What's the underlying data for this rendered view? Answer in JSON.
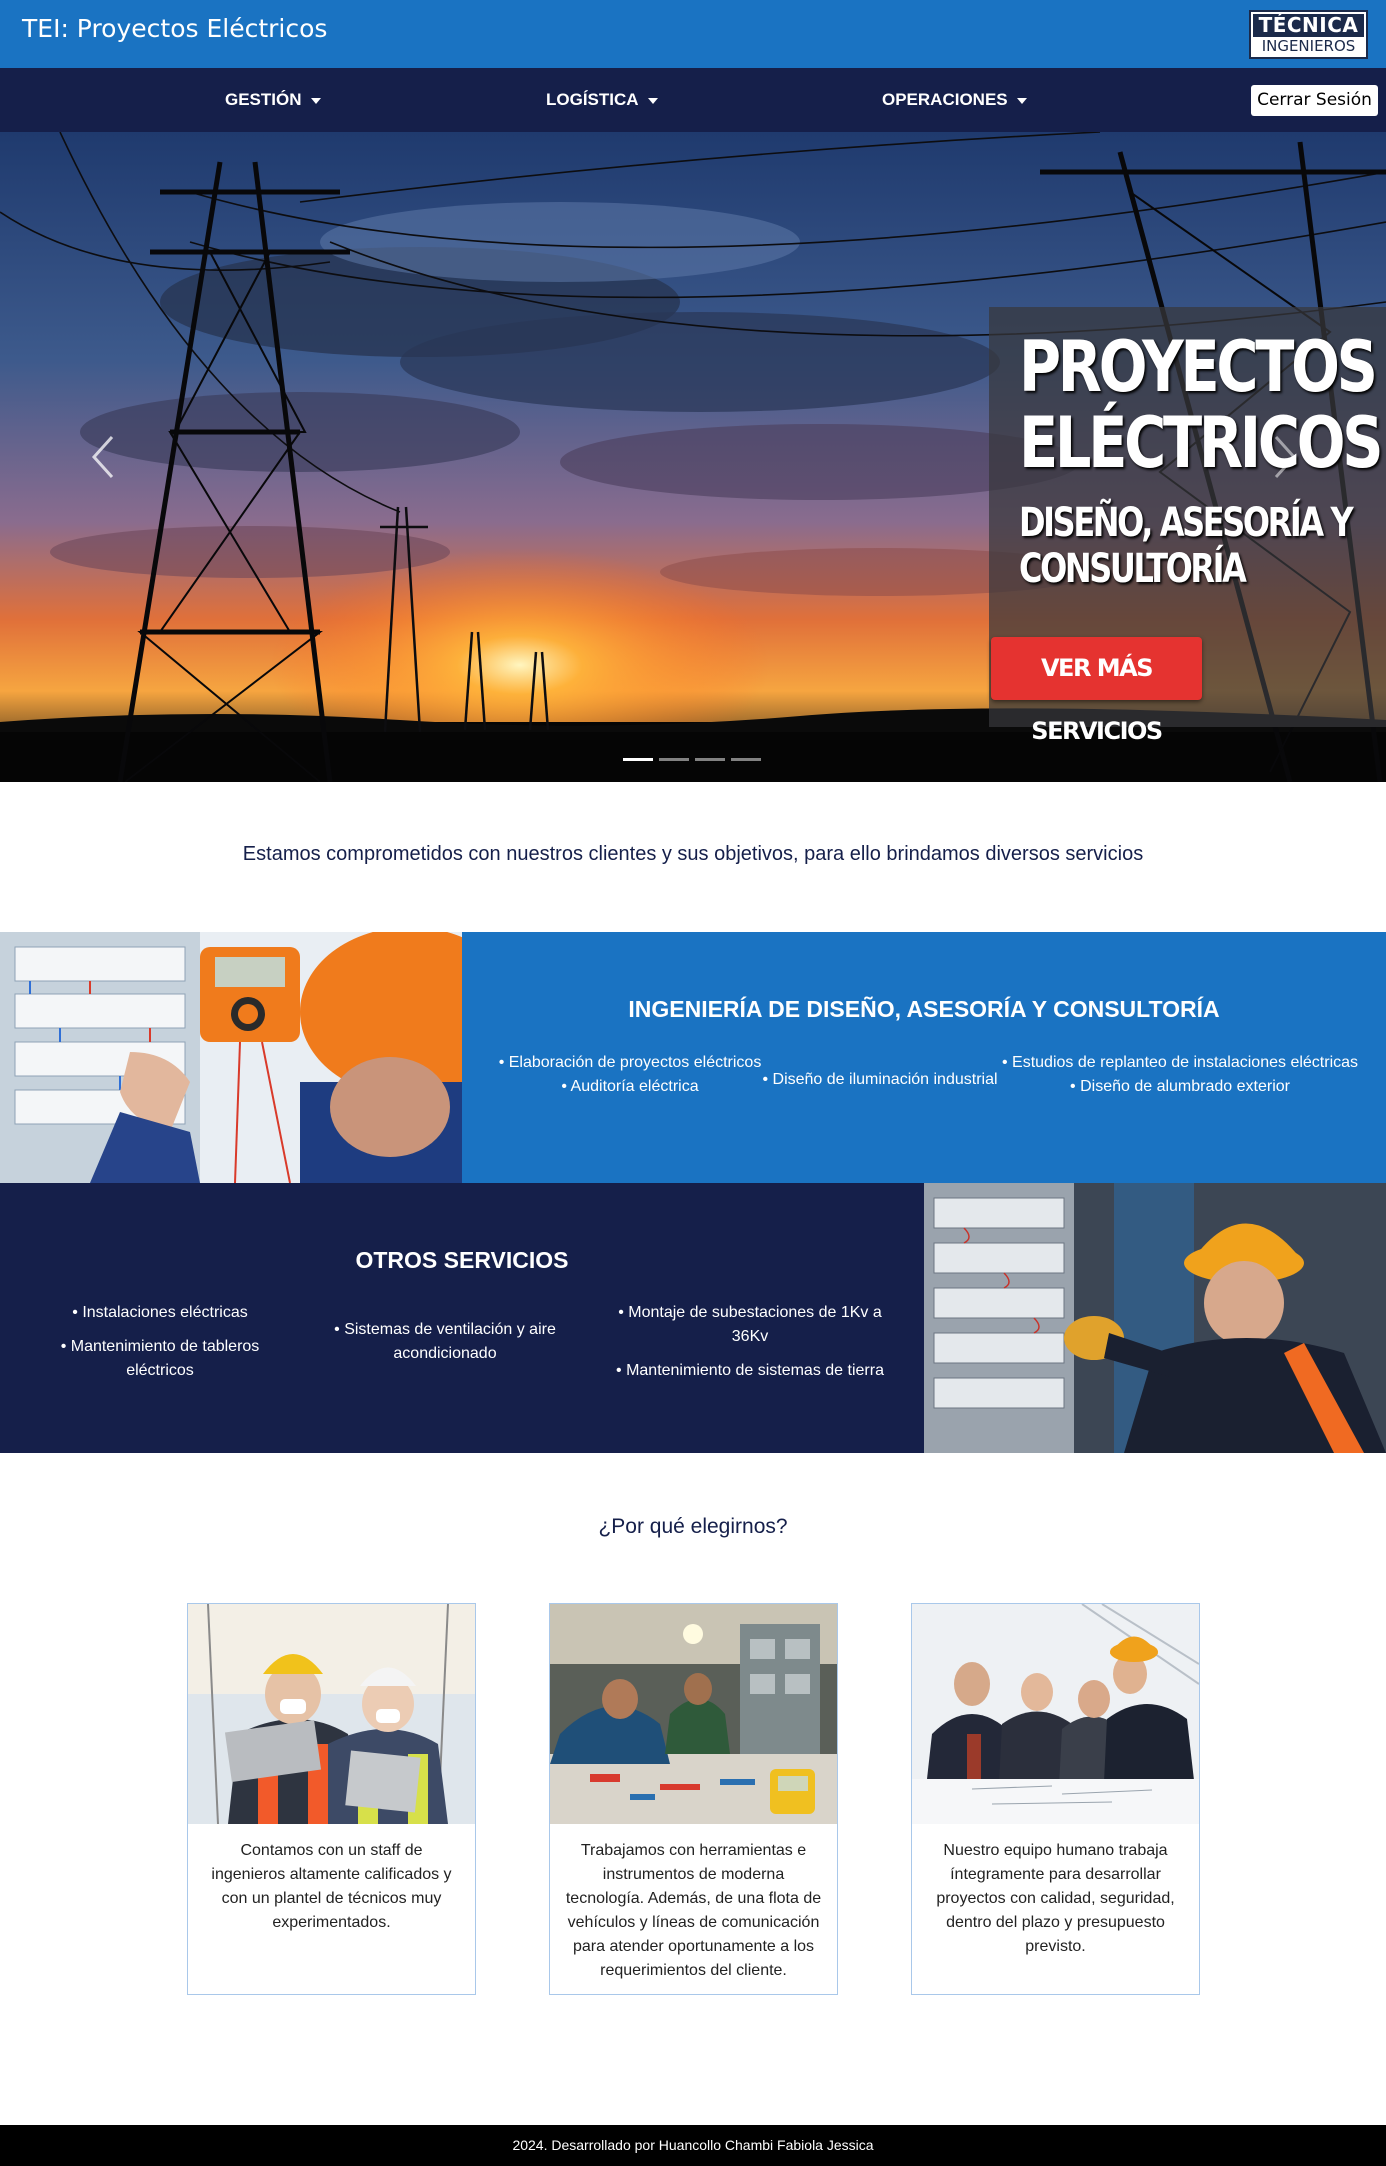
{
  "header": {
    "title": "TEI: Proyectos Eléctricos",
    "logo_line1": "TÉCNICA",
    "logo_line2": "INGENIEROS"
  },
  "nav": {
    "items": [
      {
        "label": "GESTIÓN"
      },
      {
        "label": "LOGÍSTICA"
      },
      {
        "label": "OPERACIONES"
      }
    ],
    "logout_label": "Cerrar Sesión"
  },
  "carousel": {
    "line1": "PROYECTOS",
    "line2": "ELÉCTRICOS",
    "line3": "DISEÑO, ASESORÍA Y",
    "line4": "CONSULTORÍA",
    "button": "VER MÁS SERVICIOS",
    "slide_count": 4,
    "active_slide": 1
  },
  "intro": "Estamos comprometidos con nuestros clientes y sus objetivos, para ello brindamos diversos servicios",
  "design_services": {
    "title": "INGENIERÍA DE DISEÑO, ASESORÍA Y CONSULTORÍA",
    "col1": [
      "• Elaboración de proyectos eléctricos",
      "• Auditoría eléctrica"
    ],
    "col2": [
      "• Diseño de iluminación industrial"
    ],
    "col3": [
      "• Estudios de replanteo de instalaciones eléctricas",
      "• Diseño de alumbrado exterior"
    ]
  },
  "other_services": {
    "title": "OTROS SERVICIOS",
    "col1": [
      "• Instalaciones eléctricas",
      "• Mantenimiento de tableros eléctricos"
    ],
    "col2": [
      "• Sistemas de ventilación y aire acondicionado"
    ],
    "col3": [
      "• Montaje de subestaciones de 1Kv a 36Kv",
      "• Mantenimiento de sistemas de tierra"
    ]
  },
  "why": {
    "title": "¿Por qué elegirnos?",
    "cards": [
      {
        "text": "Contamos con un staff de ingenieros altamente calificados y con un plantel de técnicos muy experimentados."
      },
      {
        "text": "Trabajamos con herramientas e instrumentos de moderna tecnología. Además, de una flota de vehículos y líneas de comunicación para atender oportunamente a los requerimientos del cliente."
      },
      {
        "text": "Nuestro equipo humano trabaja íntegramente para desarrollar proyectos con calidad, seguridad, dentro del plazo y presupuesto previsto."
      }
    ]
  },
  "footer": "2024. Desarrollado por Huancollo Chambi Fabiola Jessica",
  "colors": {
    "brand_blue": "#1a73c2",
    "navy": "#151f4a",
    "cta_red": "#e53330"
  }
}
